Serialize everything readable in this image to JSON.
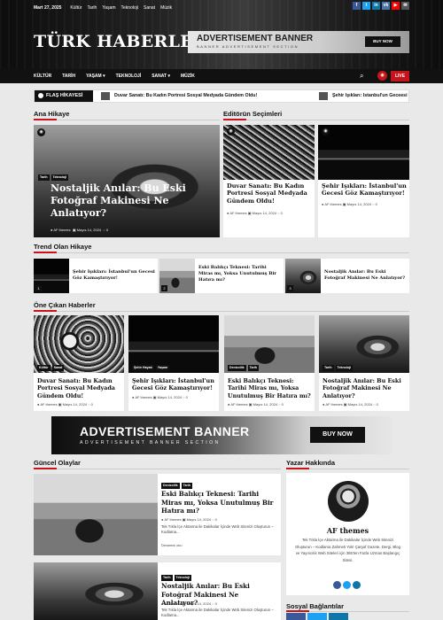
{
  "topbar": {
    "date": "Mart 27, 2025",
    "links": [
      "Kültür",
      "Tarih",
      "Yaşam",
      "Teknoloji",
      "Sanat",
      "Müzik"
    ]
  },
  "social_icons": [
    {
      "name": "facebook-icon",
      "glyph": "f",
      "color": "#3b5998"
    },
    {
      "name": "twitter-icon",
      "glyph": "t",
      "color": "#1da1f2"
    },
    {
      "name": "linkedin-icon",
      "glyph": "in",
      "color": "#0e76a8"
    },
    {
      "name": "vk-icon",
      "glyph": "vk",
      "color": "#4a76a8"
    },
    {
      "name": "youtube-icon",
      "glyph": "▶",
      "color": "#ff0000"
    },
    {
      "name": "mail-icon",
      "glyph": "✉",
      "color": "#555555"
    }
  ],
  "header": {
    "logo": "TÜRK HABERLERİ"
  },
  "ad_top": {
    "title": "ADVERTISEMENT BANNER",
    "subtitle": "BANNER ADVERTISEMENT SECTION",
    "button": "BUY NOW"
  },
  "nav": {
    "items": [
      "KÜLTÜR",
      "TARİH",
      "YAŞAM ▾",
      "TEKNOLOJİ",
      "SANAT ▾",
      "MÜZİK"
    ],
    "live": "LIVE",
    "accent": "#c6141a"
  },
  "flash": {
    "label": "FLAŞ HİKAYESİ",
    "items": [
      "Duvar Sanatı: Bu Kadın Portresi Sosyal Medyada Gündem Oldu!",
      "Şehir Işıkları: İstanbul'un Geceesi Göz Kamaştır"
    ]
  },
  "sections": {
    "main_story": "Ana Hikaye",
    "editors": "Editörün Seçimleri",
    "trending": "Trend Olan Hikaye",
    "featured": "Öne Çıkan Haberler",
    "current": "Güncel Olaylar",
    "about": "Yazar Hakkında",
    "social": "Sosyal Bağlantılar"
  },
  "main_story": {
    "tags": [
      "Tarih",
      "Teknoloji"
    ],
    "title": "Nostaljik Anılar: Bu Eski Fotoğraf Makinesi Ne Anlatıyor?",
    "author": "AF themes",
    "date": "Mayıs 14, 2024",
    "comments": "0"
  },
  "editors": [
    {
      "title": "Duvar Sanatı: Bu Kadın Portresi Sosyal Medyada Gündem Oldu!",
      "author": "AF themes",
      "date": "Mayıs 14, 2024",
      "comments": "0"
    },
    {
      "title": "Şehir Işıkları: İstanbul'un Gecesi Göz Kamaştırıyor!",
      "author": "AF themes",
      "date": "Mayıs 14, 2024",
      "comments": "0"
    }
  ],
  "trending": [
    {
      "num": "1",
      "title": "Şehir Işıkları: İstanbul'un Gecesi Göz Kamaştırıyor!"
    },
    {
      "num": "2",
      "title": "Eski Balıkçı Teknesi: Tarihi Miras mı, Yoksa Unutulmuş Bir Hatıra mı?"
    },
    {
      "num": "3",
      "title": "Nostaljik Anılar: Bu Eski Fotoğraf Makinesi Ne Anlatıyor?"
    }
  ],
  "featured": [
    {
      "tags": [
        "Kültür",
        "Sanat"
      ],
      "title": "Duvar Sanatı: Bu Kadın Portresi Sosyal Medyada Gündem Oldu!",
      "author": "AF themes",
      "date": "Mayıs 14, 2024",
      "comments": "0"
    },
    {
      "tags": [
        "Şehir Hayatı",
        "Yaşam"
      ],
      "title": "Şehir Işıkları: İstanbul'un Gecesi Göz Kamaştırıyor!",
      "author": "AF themes",
      "date": "Mayıs 14, 2024",
      "comments": "0"
    },
    {
      "tags": [
        "Denizcilik",
        "Tarih"
      ],
      "title": "Eski Balıkçı Teknesi: Tarihi Miras mı, Yoksa Unutulmuş Bir Hatıra mı?",
      "author": "AF themes",
      "date": "Mayıs 14, 2024",
      "comments": "0"
    },
    {
      "tags": [
        "Tarih",
        "Teknoloji"
      ],
      "title": "Nostaljik Anılar: Bu Eski Fotoğraf Makinesi Ne Anlatıyor?",
      "author": "AF themes",
      "date": "Mayıs 14, 2024",
      "comments": "0"
    }
  ],
  "ad_mid": {
    "title": "ADVERTISEMENT BANNER",
    "subtitle": "ADVERTISEMENT BANNER SECTION",
    "button": "BUY NOW"
  },
  "current": [
    {
      "tags": [
        "Denizcilik",
        "Tarih"
      ],
      "title": "Eski Balıkçı Teknesi: Tarihi Miras mı, Yoksa Unutulmuş Bir Hatıra mı?",
      "author": "AF themes",
      "date": "Mayıs 14, 2024",
      "comments": "0",
      "excerpt": "Tek Tıkla İçe Aktarma ile Dakikalar İçinde Web Sitenizi Oluşturun – Kodlama...",
      "more": "Devamını oku"
    },
    {
      "tags": [
        "Tarih",
        "Teknoloji"
      ],
      "title": "Nostaljik Anılar: Bu Eski Fotoğraf Makinesi Ne Anlatıyor?",
      "author": "AF themes",
      "date": "Mayıs 14, 2024",
      "comments": "0",
      "excerpt": "Tek Tıkla İçe Aktarma ile Dakikalar İçinde Web Sitenizi Oluşturun – Kodlama..."
    }
  ],
  "author_box": {
    "name": "AF themes",
    "bio": "Tek Tıkla İçe Aktarma ile Dakikalar İçinde Web Sitenizi Oluşturun – Kodlama Zahmeti Yok! Çarşaf Gazete, Dergi, Blog ve Yayıncılık Web Siteleri için 365'ten Fazla Uzman Başlangıç Sitesi."
  }
}
